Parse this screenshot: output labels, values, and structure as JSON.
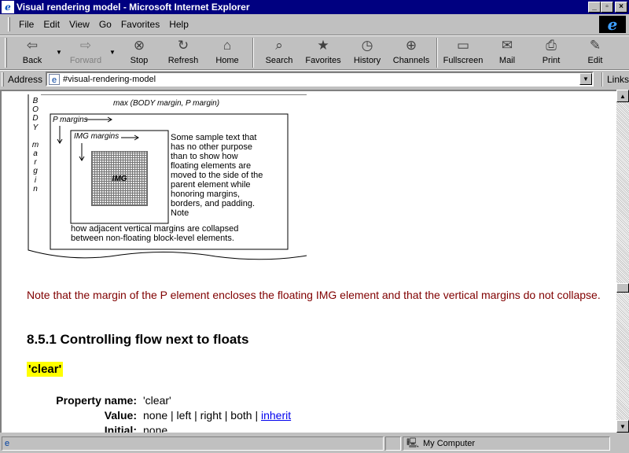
{
  "window": {
    "title": "Visual rendering model - Microsoft Internet Explorer",
    "controls": [
      "_",
      "▫",
      "×"
    ]
  },
  "menu": {
    "items": [
      {
        "label": "File",
        "key": "F"
      },
      {
        "label": "Edit",
        "key": "E"
      },
      {
        "label": "View",
        "key": "V"
      },
      {
        "label": "Go",
        "key": "G"
      },
      {
        "label": "Favorites",
        "key": "a"
      },
      {
        "label": "Help",
        "key": "H"
      }
    ],
    "logo": "e"
  },
  "toolbar": {
    "back": "Back",
    "forward": "Forward",
    "stop": "Stop",
    "refresh": "Refresh",
    "home": "Home",
    "search": "Search",
    "favorites": "Favorites",
    "history": "History",
    "channels": "Channels",
    "fullscreen": "Fullscreen",
    "mail": "Mail",
    "print": "Print",
    "edit": "Edit"
  },
  "address": {
    "label": "Address",
    "value": "#visual-rendering-model",
    "links": "Links"
  },
  "diagram": {
    "vertical_label": [
      "B",
      "O",
      "D",
      "Y",
      "",
      "m",
      "a",
      "r",
      "g",
      "i",
      "n"
    ],
    "header": "max (BODY margin, P margin)",
    "p_margins": "P margins",
    "img_margins": "IMG margins",
    "img_label": "IMG",
    "float_text": "Some sample text that has no other purpose than to show how floating elements are moved to the side of the parent element while honoring margins, borders, and padding. Note",
    "bottom_text": "how adjacent vertical margins are collapsed between non-floating block-level elements."
  },
  "content": {
    "note": "Note that the margin of the P element encloses the floating IMG element and that the vertical margins do not collapse.",
    "section_heading": "8.5.1 Controlling flow next to floats",
    "property_heading": "'clear'",
    "properties": [
      {
        "key": "Property name:",
        "value": "'clear'"
      },
      {
        "key": "Value:",
        "value": "none | left | right | both | ",
        "link": "inherit"
      },
      {
        "key": "Initial:",
        "value": "none"
      }
    ]
  },
  "status": {
    "zone": "My Computer"
  }
}
